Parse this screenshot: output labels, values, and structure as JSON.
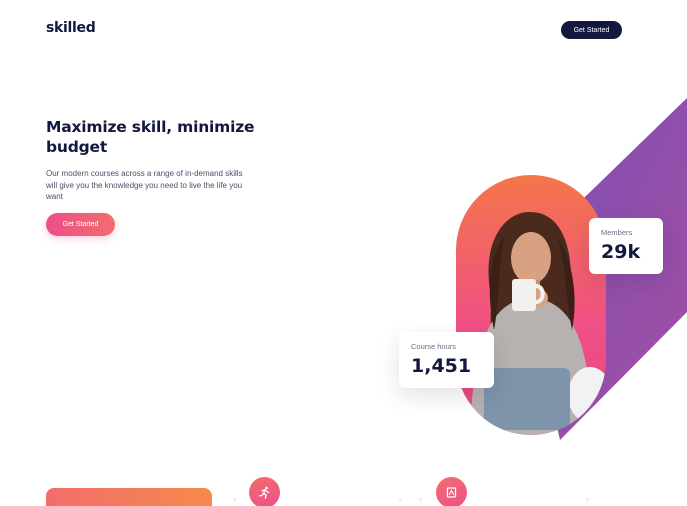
{
  "header": {
    "logo": "skilled",
    "cta_label": "Get Started"
  },
  "hero": {
    "title": "Maximize skill, minimize budget",
    "description": "Our modern courses across a range of in-demand skills will give you the knowledge you need to live the life you want",
    "cta_label": "Get Started"
  },
  "stats": {
    "members_label": "Members",
    "members_value": "29k",
    "hours_label": "Course hours",
    "hours_value": "1,451"
  },
  "icons": {
    "feature_1": "running-person-icon",
    "feature_2": "book-icon"
  },
  "colors": {
    "navy": "#13183f",
    "pink": "#ec4f8a",
    "orange": "#f58a4a",
    "purple": "#6d4fb0"
  }
}
